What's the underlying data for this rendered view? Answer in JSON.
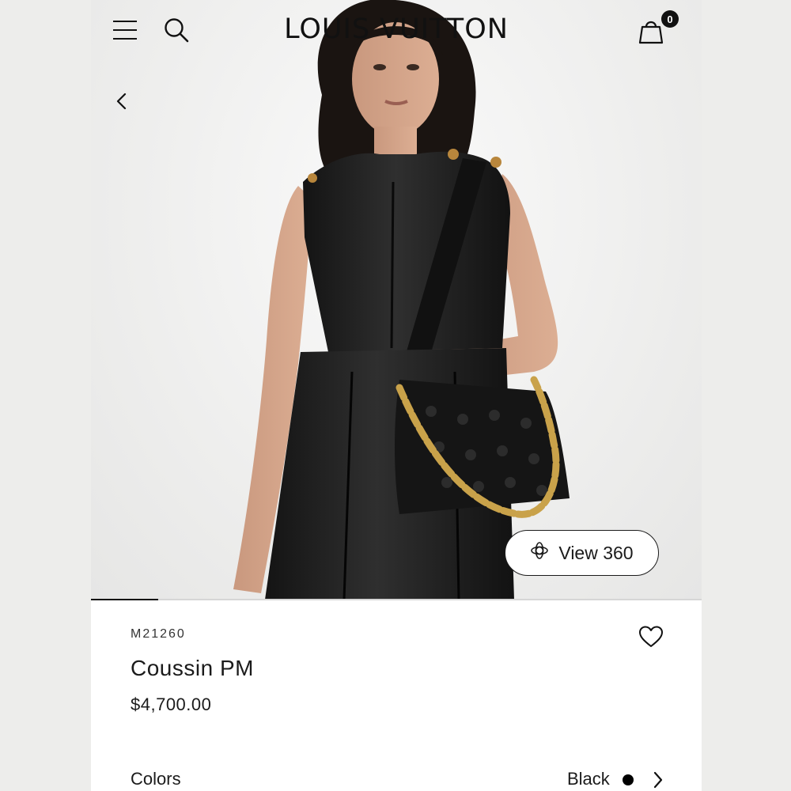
{
  "header": {
    "logo_text": "LOUIS VUITTON",
    "cart_count": "0",
    "icons": [
      "menu-icon",
      "search-icon",
      "shopping-bag-icon",
      "back-chevron-icon"
    ]
  },
  "gallery": {
    "view360_label": "View 360",
    "view360_icon": "rotate-360-icon",
    "progress_fraction": 0.11
  },
  "product": {
    "sku": "M21260",
    "name": "Coussin PM",
    "price": "$4,700.00",
    "wishlist_icon": "heart-icon"
  },
  "colors": {
    "label": "Colors",
    "selected": "Black",
    "swatch_color": "#000000",
    "icon": "chevron-right-icon"
  }
}
